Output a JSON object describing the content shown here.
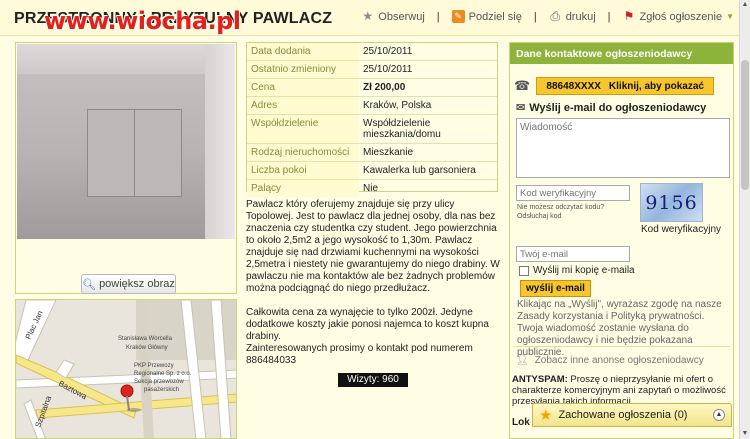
{
  "header": {
    "title": "PRZESTRONNY I PRZYTULNY PAWLACZ",
    "watermark": "www.wiocha.pl",
    "actions": [
      {
        "label": "Obserwuj",
        "icon": "star-icon"
      },
      {
        "label": "Podziel się",
        "icon": "share-icon"
      },
      {
        "label": "drukuj",
        "icon": "print-icon"
      },
      {
        "label": "Zgłoś ogłoszenie",
        "icon": "flag-icon"
      }
    ]
  },
  "photo": {
    "zoom_label": "powiększ obraz"
  },
  "details": [
    {
      "key": "Data dodania",
      "value": "25/10/2011"
    },
    {
      "key": "Ostatnio zmieniony",
      "value": "25/10/2011"
    },
    {
      "key": "Cena",
      "value": "Zł  200,00"
    },
    {
      "key": "Adres",
      "value": "Kraków, Polska"
    },
    {
      "key": "Współdzielenie",
      "value": "Współdzielenie mieszkania/domu"
    },
    {
      "key": "Rodzaj nieruchomości",
      "value": "Mieszkanie"
    },
    {
      "key": "Liczba pokoi",
      "value": "Kawalerka lub garsoniera"
    },
    {
      "key": "Palący",
      "value": "Nie"
    }
  ],
  "description": {
    "p1": "Pawlacz który oferujemy znajduje się przy ulicy Topolowej. Jest to pawlacz dla jednej osoby, dla nas bez znaczenia czy studentka czy student. Jego powierzchnia to około 2,5m2 a jego wysokość to 1,30m. Pawlacz znajduje się nad drzwiami kuchennymi na wysokości 2,5metra i niestety nie gwarantujemy do niego drabiny. W pawlaczu nie ma kontaktów ale bez żadnych problemów można podciągnąć do niego przedłużacz.",
    "p2": "Całkowita cena za wynajęcie to tylko 200zł. Jedyne dodatkowe koszty jakie ponosi najemca to koszt kupna drabiny.",
    "p3": "Zainteresowanych prosimy o kontakt pod numerem 886484033",
    "visits": "Wizyty: 960"
  },
  "map": {
    "streets": [
      "Plac Jan",
      "Baztowa",
      "Szpitalna"
    ],
    "labels": [
      "Stanisława Worcella",
      "Kraków Główny",
      "PKP Przewozy Regionalne Sp. z o.o. Sekcja przewozów pasażerskich"
    ]
  },
  "contact": {
    "heading": "Dane kontaktowe ogłoszeniodawcy",
    "phone": "88648XXXX",
    "phone_cta": "Kliknij, aby pokazać",
    "email_title": "Wyślij e-mail do ogłoszeniodawcy",
    "message_placeholder": "Wiadomość",
    "code_placeholder": "Kod weryfikacyjny",
    "cant_read": "Nie możesz odczytać kodu?",
    "listen": "Odsłuchaj kod",
    "captcha_text": "9156",
    "captcha_label": "Kod weryfikacyjny",
    "email_placeholder": "Twój e-mail",
    "copy_label": "Wyślij mi kopię e-maila",
    "send_label": "wyślij e-mail",
    "consent": "Klikając na „Wyślij\", wyrażasz zgodę na nasze Zasady korzystania i Polityką prywatności. Twoja wiadomość zostanie wysłana do ogłoszeniodawcy i nie będzie pokazana publicznie.",
    "other_ads": "Zobacz inne anonse ogłoszeniodawcy",
    "antispam_label": "ANTYSPAM:",
    "antispam_text": "Proszę o nieprzysyłanie mi ofert o charakterze komercyjnym ani zapytań o możliwość przesyłania takich informacji",
    "fold_text": "Lok"
  },
  "saved": {
    "label": "Zachowane ogłoszenia (0)"
  }
}
